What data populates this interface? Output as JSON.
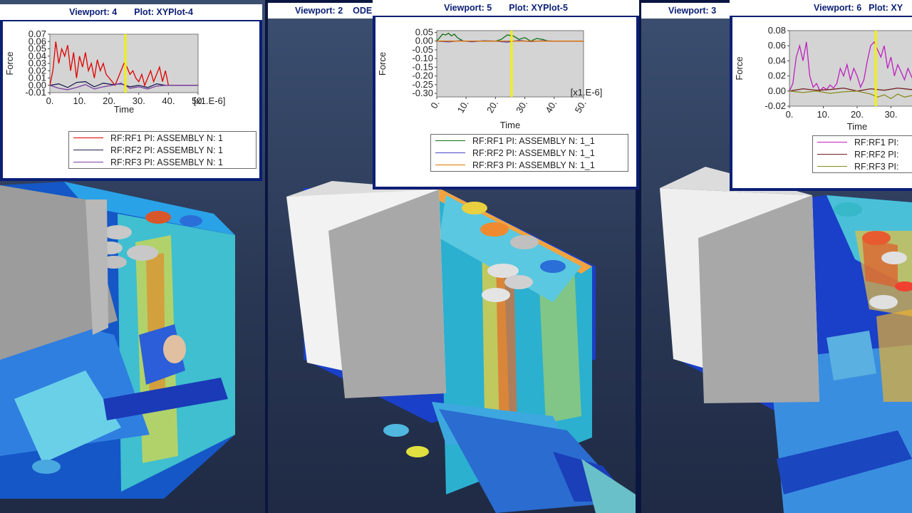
{
  "viewports": {
    "vp4_plot": {
      "viewport_label": "Viewport: 4",
      "plot_label": "Plot: XYPlot-4"
    },
    "vp2": {
      "viewport_label": "Viewport: 2",
      "plot_label": "ODE"
    },
    "vp5_plot": {
      "viewport_label": "Viewport: 5",
      "plot_label": "Plot: XYPlot-5"
    },
    "vp3": {
      "viewport_label": "Viewport: 3"
    },
    "vp6_plot": {
      "viewport_label": "Viewport: 6",
      "plot_label": "Plot: XY"
    }
  },
  "chart_data": [
    {
      "type": "line",
      "ylabel": "Force",
      "xlabel": "Time",
      "x_multiplier": "[x1.E-6]",
      "xlim": [
        0,
        50
      ],
      "ylim": [
        -0.01,
        0.07
      ],
      "xticks": [
        "0.",
        "10.",
        "20.",
        "30.",
        "40.",
        "50."
      ],
      "yticks": [
        "0.07",
        "0.06",
        "0.05",
        "0.04",
        "0.03",
        "0.02",
        "0.01",
        "0.00",
        "-0.01"
      ],
      "cursor_x": 25.5,
      "series": [
        {
          "name": "RF:RF1 PI: ASSEMBLY N: 1",
          "color": "#e00000",
          "x": [
            0,
            1,
            2,
            3,
            4,
            5,
            6,
            7,
            8,
            9,
            10,
            11,
            12,
            13,
            14,
            15,
            16,
            17,
            18,
            19,
            20,
            21,
            22,
            23,
            24,
            25,
            26,
            27,
            28,
            29,
            30,
            31,
            32,
            33,
            34,
            35,
            36,
            37,
            38,
            39,
            40,
            41,
            42,
            45,
            50
          ],
          "y": [
            0.0,
            0.02,
            0.06,
            0.03,
            0.05,
            0.04,
            0.055,
            0.02,
            0.045,
            0.01,
            0.04,
            0.025,
            0.045,
            0.02,
            0.03,
            0.01,
            0.035,
            0.02,
            0.03,
            0.015,
            0.01,
            0.005,
            0.0,
            0.01,
            0.02,
            0.03,
            0.025,
            0.015,
            0.02,
            0.01,
            0.005,
            0.015,
            0.0,
            0.01,
            0.02,
            0.005,
            0.015,
            0.025,
            0.005,
            0.02,
            0.0,
            0.0,
            0.0,
            0.0,
            0.0
          ]
        },
        {
          "name": "RF:RF2 PI: ASSEMBLY N: 1",
          "color": "#202050",
          "x": [
            0,
            3,
            6,
            9,
            12,
            15,
            18,
            21,
            24,
            27,
            30,
            33,
            36,
            39,
            42,
            46,
            50
          ],
          "y": [
            0.0,
            0.002,
            -0.003,
            0.004,
            0.005,
            -0.002,
            0.003,
            0.001,
            0.002,
            -0.002,
            0.0,
            -0.003,
            0.002,
            0.0,
            0.0,
            0.0,
            0.0
          ]
        },
        {
          "name": "RF:RF3 PI: ASSEMBLY N: 1",
          "color": "#7a3ea0",
          "x": [
            0,
            3,
            6,
            9,
            12,
            15,
            18,
            21,
            24,
            27,
            30,
            33,
            36,
            39,
            42,
            46,
            50
          ],
          "y": [
            0.0,
            -0.004,
            -0.006,
            -0.003,
            0.001,
            -0.005,
            -0.002,
            0.0,
            0.003,
            -0.004,
            -0.002,
            -0.005,
            -0.001,
            0.0,
            0.0,
            0.0,
            0.0
          ]
        }
      ]
    },
    {
      "type": "line",
      "ylabel": "Force",
      "xlabel": "Time",
      "x_multiplier": "[x1.E-6]",
      "xlim": [
        0,
        50
      ],
      "ylim": [
        -0.32,
        0.06
      ],
      "xticks": [
        "0.",
        "10.",
        "20.",
        "30.",
        "40.",
        "50."
      ],
      "yticks": [
        "0.05",
        "0.00",
        "-0.05",
        "-0.10",
        "-0.15",
        "-0.20",
        "-0.25",
        "-0.30"
      ],
      "cursor_x": 25.5,
      "series": [
        {
          "name": "RF:RF1 PI: ASSEMBLY N: 1_1",
          "color": "#107010",
          "x": [
            0,
            1,
            2,
            3,
            4,
            5,
            6,
            7,
            8,
            9,
            10,
            20,
            22,
            24,
            26,
            28,
            30,
            32,
            34,
            36,
            38,
            40,
            50
          ],
          "y": [
            0.0,
            0.02,
            0.04,
            0.035,
            0.045,
            0.03,
            0.04,
            0.02,
            0.01,
            0.0,
            0.0,
            0.0,
            0.01,
            0.035,
            0.03,
            0.01,
            0.02,
            0.0,
            0.015,
            0.01,
            0.0,
            0.0,
            0.0
          ]
        },
        {
          "name": "RF:RF2 PI: ASSEMBLY N: 1_1",
          "color": "#4848c8",
          "x": [
            0,
            4,
            8,
            12,
            16,
            20,
            24,
            28,
            32,
            36,
            40,
            50
          ],
          "y": [
            0.0,
            -0.005,
            0.003,
            -0.004,
            0.002,
            0.0,
            -0.006,
            0.004,
            -0.003,
            0.002,
            0.0,
            0.0
          ]
        },
        {
          "name": "RF:RF3 PI: ASSEMBLY N: 1_1",
          "color": "#e07000",
          "x": [
            0,
            50
          ],
          "y": [
            0.0,
            0.0
          ]
        }
      ]
    },
    {
      "type": "line",
      "ylabel": "Force",
      "xlabel": "Time",
      "xlim": [
        0,
        40
      ],
      "ylim": [
        -0.02,
        0.08
      ],
      "xticks": [
        "0.",
        "10.",
        "20.",
        "30."
      ],
      "yticks": [
        "0.08",
        "0.06",
        "0.04",
        "0.02",
        "0.00",
        "-0.02"
      ],
      "cursor_x": 25.5,
      "series": [
        {
          "name": "RF:RF1 PI:",
          "color": "#c020c0",
          "x": [
            0,
            1,
            2,
            3,
            4,
            5,
            6,
            7,
            8,
            9,
            10,
            11,
            12,
            13,
            14,
            15,
            16,
            17,
            18,
            19,
            20,
            21,
            22,
            23,
            24,
            25,
            26,
            27,
            28,
            29,
            30,
            31,
            32,
            33,
            34,
            35,
            36,
            37,
            38,
            39,
            40
          ],
          "y": [
            0.0,
            0.01,
            0.045,
            0.06,
            0.04,
            0.065,
            0.02,
            0.005,
            0.01,
            0.0,
            0.005,
            0.002,
            0.008,
            0.004,
            0.01,
            0.03,
            0.02,
            0.035,
            0.015,
            0.03,
            0.02,
            0.005,
            0.015,
            0.04,
            0.06,
            0.065,
            0.055,
            0.045,
            0.06,
            0.03,
            0.045,
            0.02,
            0.035,
            0.025,
            0.015,
            0.03,
            0.02,
            0.01,
            0.025,
            0.015,
            0.02
          ]
        },
        {
          "name": "RF:RF2 PI:",
          "color": "#702020",
          "x": [
            0,
            4,
            8,
            12,
            16,
            20,
            24,
            28,
            32,
            36,
            40
          ],
          "y": [
            0.0,
            0.003,
            0.001,
            0.002,
            0.004,
            0.0,
            0.003,
            0.001,
            0.004,
            0.002,
            0.003
          ]
        },
        {
          "name": "RF:RF3 PI:",
          "color": "#8a8a20",
          "x": [
            0,
            4,
            8,
            12,
            16,
            20,
            24,
            26,
            28,
            30,
            32,
            34,
            36,
            38,
            40
          ],
          "y": [
            0.0,
            -0.002,
            0.0,
            -0.003,
            -0.001,
            0.0,
            -0.004,
            -0.008,
            -0.005,
            -0.01,
            -0.004,
            -0.008,
            -0.006,
            -0.003,
            -0.005
          ]
        }
      ]
    }
  ]
}
